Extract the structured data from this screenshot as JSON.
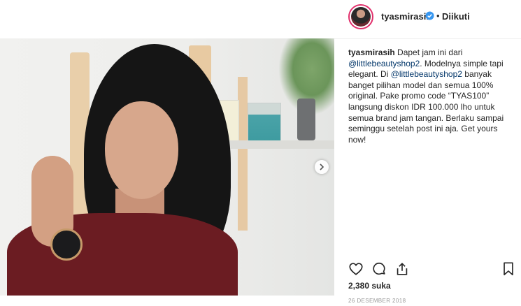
{
  "header": {
    "username": "tyasmirasih",
    "separator": "•",
    "follow_status": "Diikuti"
  },
  "caption": {
    "username": "tyasmirasih",
    "part1": " Dapet jam ini dari ",
    "mention1": "@littlebeautyshop2",
    "part2": ". Modelnya simple tapi elegant. Di ",
    "mention2": "@littlebeautyshop2",
    "part3": " banyak banget pilihan model dan semua 100% original. Pake promo code “TYAS100” langsung diskon IDR 100.000 lho untuk semua brand jam tangan. Berlaku sampai seminggu setelah post ini aja. Get yours now!"
  },
  "post": {
    "likes": "2,380 suka",
    "date": "26 DESEMBER 2018"
  },
  "icons": {
    "verified": "verified-badge-icon",
    "next": "chevron-right-icon",
    "like": "heart-icon",
    "comment": "comment-icon",
    "share": "share-icon",
    "save": "bookmark-icon"
  },
  "colors": {
    "verified": "#3897f0",
    "mention": "#003569",
    "date": "#999999"
  }
}
